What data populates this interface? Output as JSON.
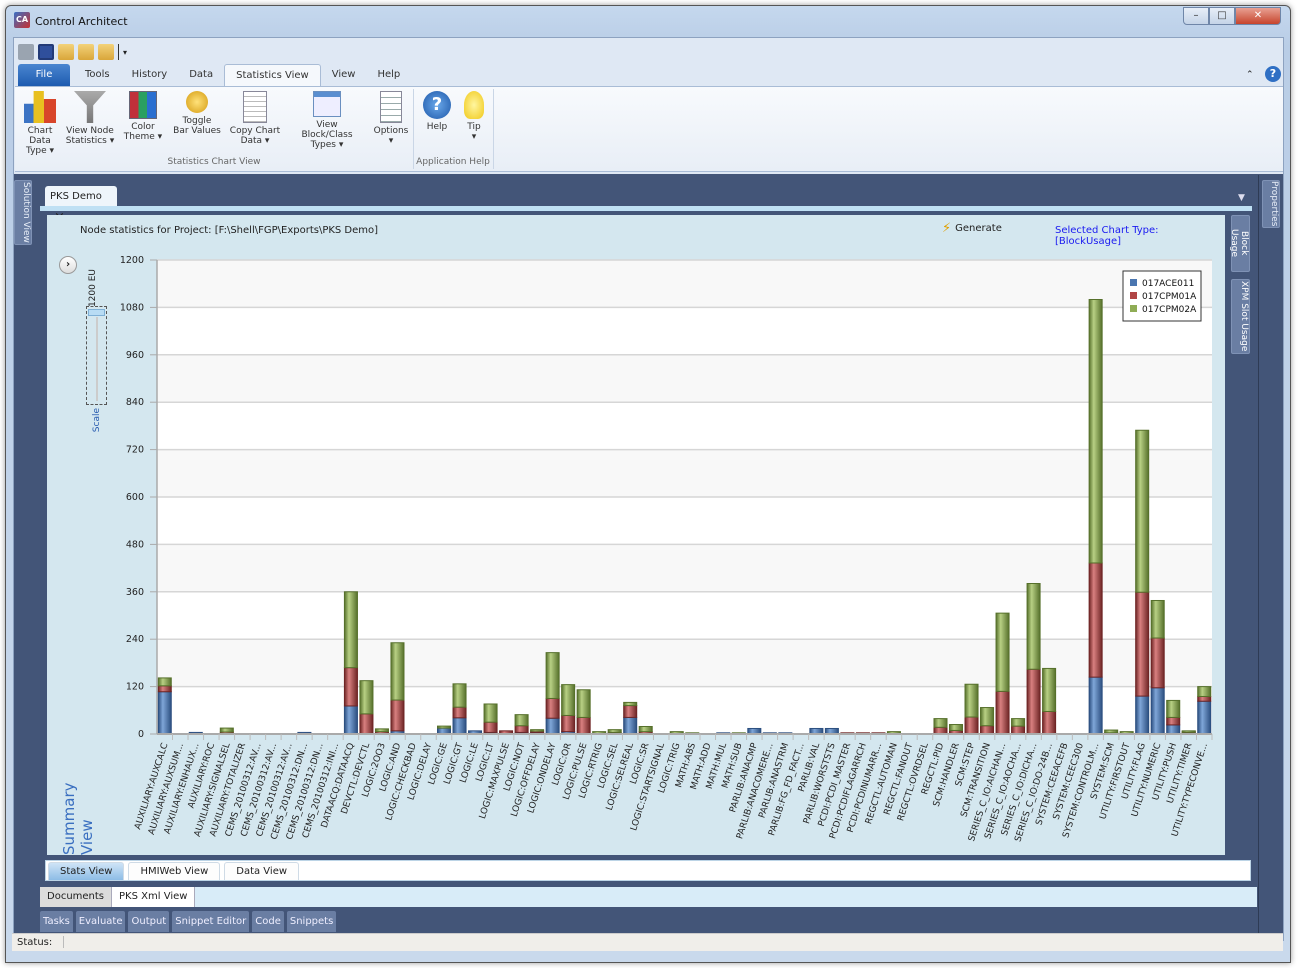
{
  "window": {
    "title": "Control Architect",
    "app_icon": "CA"
  },
  "quick_access": [
    "print-icon",
    "save-icon",
    "open-folder-icon",
    "export-folder-icon",
    "import-folder-icon",
    "customize-dropdown-icon"
  ],
  "ribbon_tabs": [
    {
      "label": "File"
    },
    {
      "label": "Tools"
    },
    {
      "label": "History"
    },
    {
      "label": "Data"
    },
    {
      "label": "Statistics View",
      "active": true
    },
    {
      "label": "View"
    },
    {
      "label": "Help"
    }
  ],
  "ribbon": {
    "buttons": [
      {
        "l1": "Chart Data",
        "l2": "Type ▾",
        "icon": "bar-chart-icon"
      },
      {
        "l1": "View Node",
        "l2": "Statistics ▾",
        "icon": "filter-add-icon"
      },
      {
        "l1": "Color",
        "l2": "Theme ▾",
        "icon": "color-grid-icon"
      },
      {
        "l1": "Toggle",
        "l2": "Bar Values",
        "icon": "pushpin-icon"
      },
      {
        "l1": "Copy Chart",
        "l2": "Data ▾",
        "icon": "copy-icon"
      },
      {
        "l1": "View Block/Class",
        "l2": "Types ▾",
        "icon": "window-search-icon"
      },
      {
        "l1": "Options",
        "l2": "▾",
        "icon": "list-document-icon"
      },
      {
        "l1": "Help",
        "l2": "",
        "icon": "help-icon"
      },
      {
        "l1": "Tip",
        "l2": "▾",
        "icon": "lightbulb-icon"
      }
    ],
    "groups": [
      "Statistics Chart View",
      "Application Help"
    ]
  },
  "side_tabs": {
    "left": "Solution View",
    "right": "Properties",
    "panel_right": [
      "Block Usage",
      "XPM Slot Usage"
    ]
  },
  "document_tab": {
    "label": "PKS Demo",
    "close": "×"
  },
  "panel": {
    "heading": "Node statistics for Project: [F:\\Shell\\FGP\\Exports\\PKS Demo]",
    "generate": "Generate",
    "selected_chart_type": "Selected Chart Type: [BlockUsage]",
    "scale_label": "Scale",
    "scale_value": "1200 EU",
    "summary_label": "Summary View"
  },
  "view_tabs": [
    {
      "label": "Stats View",
      "active": true
    },
    {
      "label": "HMIWeb View"
    },
    {
      "label": "Data View"
    }
  ],
  "doc_tabs": [
    {
      "label": "Documents"
    },
    {
      "label": "PKS Xml View"
    }
  ],
  "tool_tabs": [
    "Tasks",
    "Evaluate",
    "Output",
    "Snippet Editor",
    "Code",
    "Snippets"
  ],
  "status": {
    "label": "Status:"
  },
  "chart_data": {
    "type": "bar",
    "stacked": true,
    "ylim": [
      0,
      1200
    ],
    "yticks": [
      0,
      120,
      240,
      360,
      480,
      600,
      720,
      840,
      960,
      1080,
      1200
    ],
    "grid": true,
    "legend_position": "top-right",
    "categories": [
      "AUXILIARY:AUXCALC",
      "AUXILIARY:AUXSUM...",
      "AUXILIARY:ENHAUX...",
      "AUXILIARY:ROC",
      "AUXILIARY:SIGNALSEL",
      "AUXILIARY:TOTALIZER",
      "CEMS_20100312:AV...",
      "CEMS_20100312:AV...",
      "CEMS_20100312:AV...",
      "CEMS_20100312:DN...",
      "CEMS_20100312:DN...",
      "CEMS_20100312:INI...",
      "DATAACQ:DATAACQ",
      "DEVCTL:DEVCTL",
      "LOGIC:2OO3",
      "LOGIC:AND",
      "LOGIC:CHECKBAD",
      "LOGIC:DELAY",
      "LOGIC:GE",
      "LOGIC:GT",
      "LOGIC:LE",
      "LOGIC:LT",
      "LOGIC:MAXPULSE",
      "LOGIC:NOT",
      "LOGIC:OFFDELAY",
      "LOGIC:ONDELAY",
      "LOGIC:OR",
      "LOGIC:PULSE",
      "LOGIC:RTRIG",
      "LOGIC:SEL",
      "LOGIC:SELREAL",
      "LOGIC:SR",
      "LOGIC:STARTSIGNAL",
      "LOGIC:TRIG",
      "MATH:ABS",
      "MATH:ADD",
      "MATH:MUL",
      "MATH:SUB",
      "PARLIB:ANACMP",
      "PARLIB:ANACOMERE...",
      "PARLIB:ANASTRM",
      "PARLIB:FG_FD_FACT...",
      "PARLIB:VAL",
      "PARLIB:WORSTSTS",
      "PCDI:PCDI_MASTER",
      "PCDI:PCDIFLAGARRCH",
      "PCDI:PCDINUMARR...",
      "REGCTL:AUTOMAN",
      "REGCTL:FANOUT",
      "REGCTL:OVRDSEL",
      "REGCTL:PID",
      "SCM:HANDLER",
      "SCM:STEP",
      "SCM:TRANSITION",
      "SERIES_C_IO:AICHAN...",
      "SERIES_C_IO:AOCHA...",
      "SERIES_C_IO:DICHA...",
      "SERIES_C_IO:DO-24B...",
      "SYSTEM:CEEACEFB",
      "SYSTEM:CEEC300",
      "SYSTEM:CONTROLM...",
      "SYSTEM:SCM",
      "UTILITY:FIRSTOUT",
      "UTILITY:FLAG",
      "UTILITY:NUMERIC",
      "UTILITY:PUSH",
      "UTILITY:TIMER",
      "UTILITY:TYPECONVE..."
    ],
    "series": [
      {
        "name": "017ACE011",
        "color": "#4a76b0",
        "values": [
          107,
          0,
          4,
          0,
          0,
          0,
          0,
          0,
          0,
          4,
          0,
          0,
          71,
          0,
          0,
          8,
          0,
          0,
          15,
          41,
          8,
          4,
          0,
          4,
          4,
          40,
          6,
          0,
          0,
          0,
          42,
          0,
          0,
          0,
          0,
          0,
          3,
          0,
          14,
          3,
          3,
          0,
          14,
          14,
          0,
          0,
          0,
          0,
          0,
          0,
          0,
          0,
          0,
          0,
          0,
          0,
          0,
          0,
          0,
          0,
          144,
          0,
          0,
          96,
          117,
          23,
          4,
          83
        ]
      },
      {
        "name": "017CPM01A",
        "color": "#b04545",
        "values": [
          15,
          0,
          0,
          0,
          5,
          0,
          0,
          0,
          0,
          0,
          0,
          0,
          97,
          51,
          6,
          78,
          0,
          0,
          0,
          27,
          0,
          26,
          8,
          17,
          4,
          50,
          41,
          42,
          0,
          4,
          30,
          6,
          0,
          0,
          0,
          0,
          0,
          0,
          0,
          0,
          0,
          0,
          0,
          0,
          3,
          3,
          3,
          0,
          0,
          0,
          17,
          9,
          43,
          21,
          108,
          20,
          164,
          57,
          0,
          0,
          289,
          3,
          0,
          263,
          126,
          19,
          3,
          12
        ]
      },
      {
        "name": "017CPM02A",
        "color": "#8fac55",
        "values": [
          20,
          0,
          0,
          0,
          10,
          0,
          0,
          0,
          0,
          0,
          0,
          0,
          192,
          84,
          7,
          145,
          0,
          0,
          5,
          59,
          0,
          46,
          0,
          28,
          3,
          116,
          78,
          70,
          6,
          7,
          8,
          13,
          0,
          6,
          3,
          0,
          0,
          3,
          0,
          0,
          0,
          0,
          0,
          0,
          0,
          0,
          0,
          6,
          0,
          0,
          22,
          15,
          83,
          46,
          198,
          19,
          217,
          109,
          0,
          0,
          667,
          7,
          6,
          410,
          95,
          43,
          1,
          25
        ]
      }
    ]
  }
}
